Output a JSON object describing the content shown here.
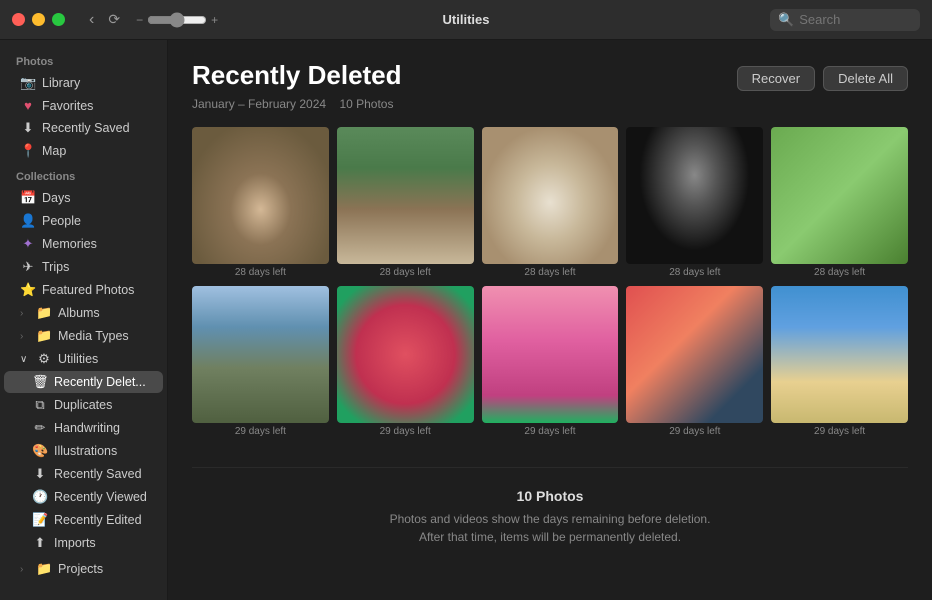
{
  "titlebar": {
    "title": "Utilities",
    "search_placeholder": "Search",
    "nav": {
      "back": "‹",
      "rotate": "⟳",
      "zoom_minus": "−",
      "zoom_plus": "+"
    }
  },
  "sidebar": {
    "photos_section": "Photos",
    "collections_section": "Collections",
    "photos_items": [
      {
        "id": "library",
        "label": "Library",
        "icon": "📷"
      },
      {
        "id": "favorites",
        "label": "Favorites",
        "icon": "♥"
      },
      {
        "id": "recently-saved",
        "label": "Recently Saved",
        "icon": "⬇"
      },
      {
        "id": "map",
        "label": "Map",
        "icon": "📍"
      }
    ],
    "collections_items": [
      {
        "id": "days",
        "label": "Days",
        "icon": "📅"
      },
      {
        "id": "people",
        "label": "People",
        "icon": "👤"
      },
      {
        "id": "memories",
        "label": "Memories",
        "icon": "✦"
      },
      {
        "id": "trips",
        "label": "Trips",
        "icon": "✈"
      },
      {
        "id": "featured-photos",
        "label": "Featured Photos",
        "icon": "⭐"
      },
      {
        "id": "albums",
        "label": "Albums",
        "icon": "📁",
        "has_chevron": true
      },
      {
        "id": "media-types",
        "label": "Media Types",
        "icon": "📁",
        "has_chevron": true
      },
      {
        "id": "utilities",
        "label": "Utilities",
        "icon": "⚙",
        "expanded": true
      }
    ],
    "utilities_items": [
      {
        "id": "recently-deleted",
        "label": "Recently Delet...",
        "icon": "🗑",
        "active": true
      },
      {
        "id": "duplicates",
        "label": "Duplicates",
        "icon": "⧉"
      },
      {
        "id": "handwriting",
        "label": "Handwriting",
        "icon": "✏"
      },
      {
        "id": "illustrations",
        "label": "Illustrations",
        "icon": "🎨"
      },
      {
        "id": "recently-saved-util",
        "label": "Recently Saved",
        "icon": "⬇"
      },
      {
        "id": "recently-viewed",
        "label": "Recently Viewed",
        "icon": "🕐"
      },
      {
        "id": "recently-edited",
        "label": "Recently Edited",
        "icon": "📝"
      },
      {
        "id": "imports",
        "label": "Imports",
        "icon": "⬆"
      }
    ],
    "projects_label": "Projects",
    "projects_chevron": "›"
  },
  "content": {
    "title": "Recently Deleted",
    "subtitle": "January – February 2024",
    "photo_count": "10 Photos",
    "recover_btn": "Recover",
    "delete_all_btn": "Delete All",
    "photos": [
      {
        "id": 1,
        "days_left": "28 days left",
        "type": "dog-fluffy"
      },
      {
        "id": 2,
        "days_left": "28 days left",
        "type": "dog-outdoor"
      },
      {
        "id": 3,
        "days_left": "28 days left",
        "type": "dog-white"
      },
      {
        "id": 4,
        "days_left": "28 days left",
        "type": "girl-bw"
      },
      {
        "id": 5,
        "days_left": "28 days left",
        "type": "girl-green"
      },
      {
        "id": 6,
        "days_left": "29 days left",
        "type": "building"
      },
      {
        "id": 7,
        "days_left": "29 days left",
        "type": "berries"
      },
      {
        "id": 8,
        "days_left": "29 days left",
        "type": "pink-cake"
      },
      {
        "id": 9,
        "days_left": "29 days left",
        "type": "watermelon"
      },
      {
        "id": 10,
        "days_left": "29 days left",
        "type": "beach"
      }
    ],
    "footer": {
      "count": "10 Photos",
      "line1": "Photos and videos show the days remaining before deletion.",
      "line2": "After that time, items will be permanently deleted."
    }
  }
}
